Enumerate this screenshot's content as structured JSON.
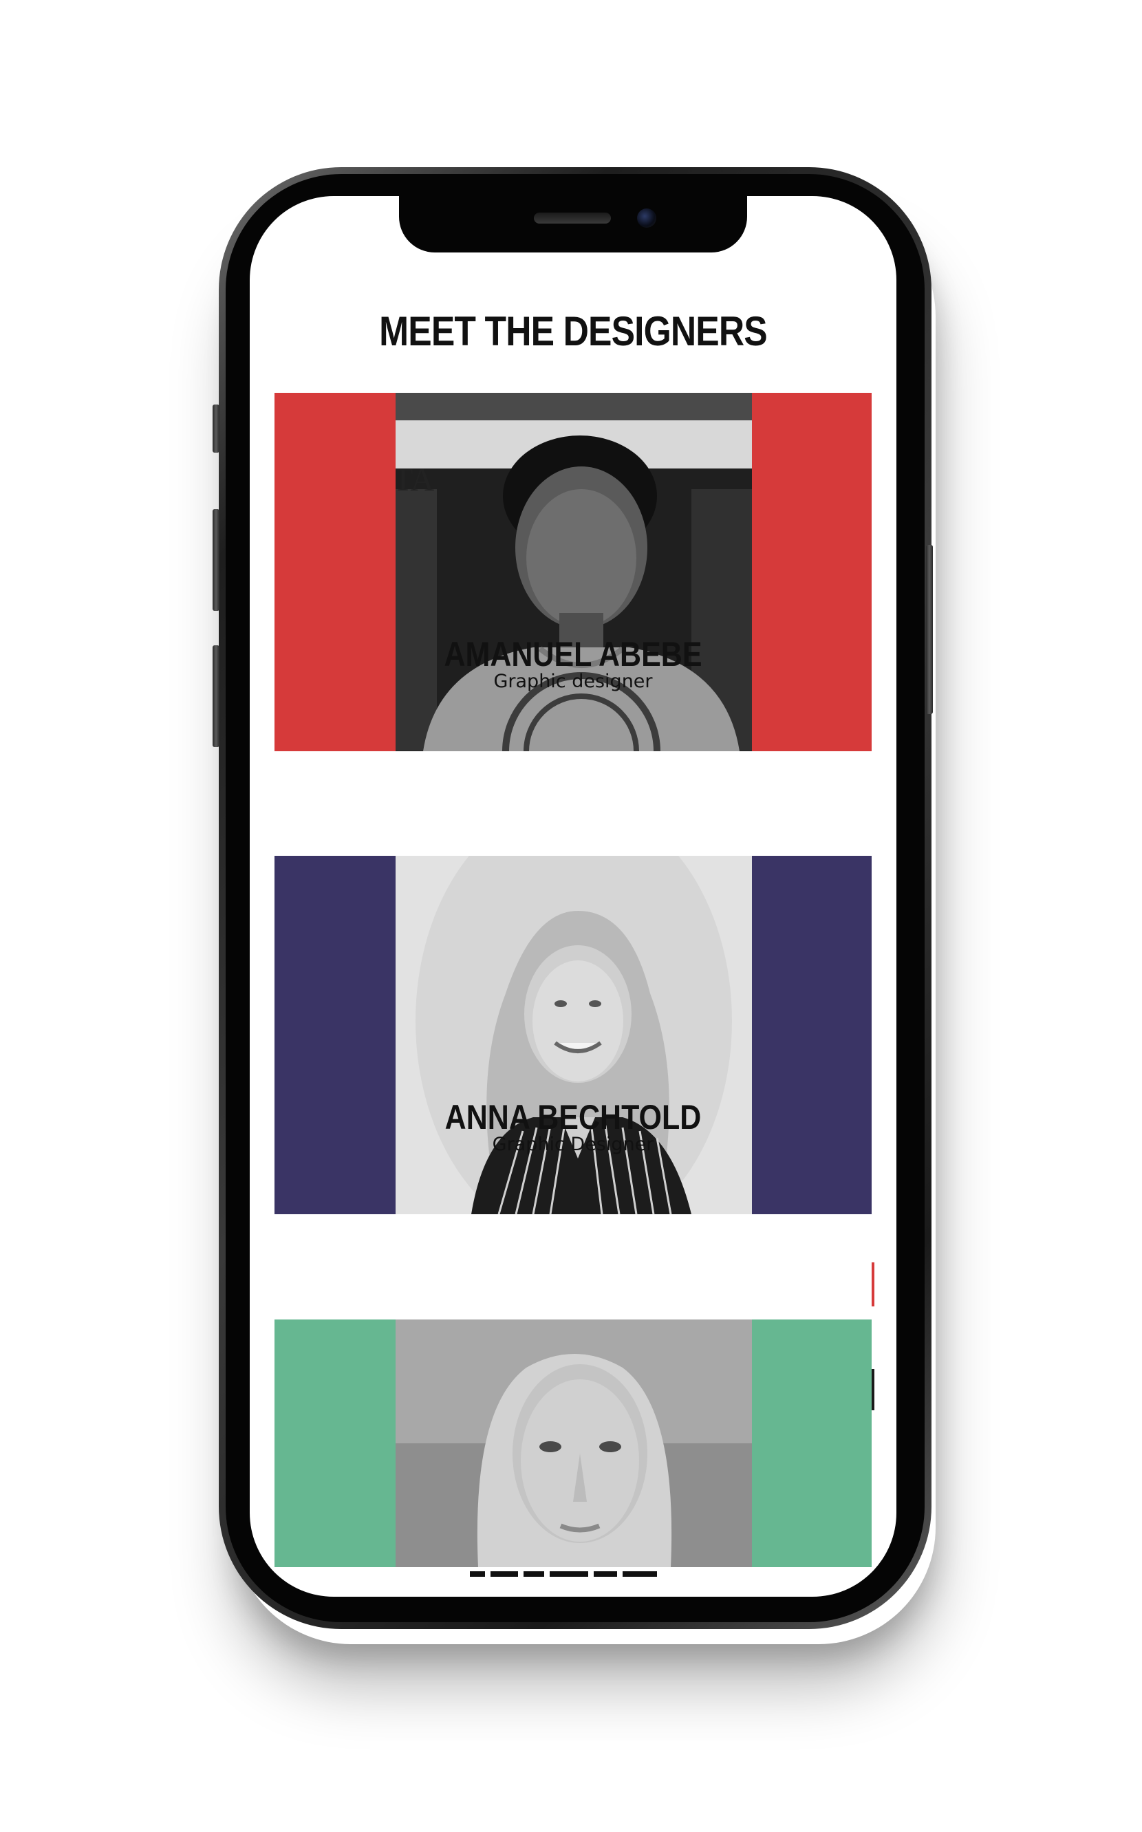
{
  "page": {
    "title": "MEET THE DESIGNERS"
  },
  "designers": [
    {
      "name": "AMANUEL ABEBE",
      "role": "Graphic designer",
      "banner_color": "#d63a3a"
    },
    {
      "name": "ANNA BECHTOLD",
      "role": "Graphic Designer",
      "banner_color": "#3a3465"
    },
    {
      "banner_color": "#66b791"
    }
  ],
  "icons": [
    "speaker-grille-icon",
    "front-camera-icon"
  ]
}
